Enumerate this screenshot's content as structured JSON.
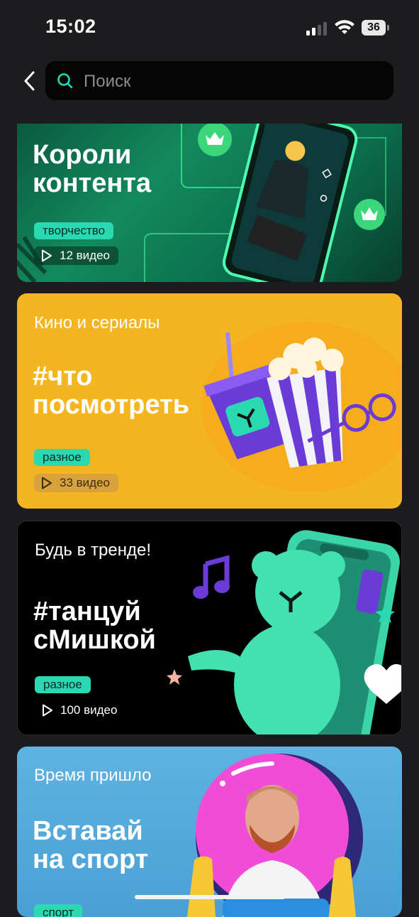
{
  "status_bar": {
    "time": "15:02",
    "battery": "36"
  },
  "search": {
    "placeholder": "Поиск"
  },
  "cards": [
    {
      "kicker": "",
      "title_line1": "Короли",
      "title_line2": "контента",
      "tag": "творчество",
      "count": "12 видео"
    },
    {
      "kicker": "Кино и сериалы",
      "title_line1": "#что",
      "title_line2": "посмотреть",
      "tag": "разное",
      "count": "33 видео"
    },
    {
      "kicker": "Будь в тренде!",
      "title_line1": "#танцуй",
      "title_line2": "сМишкой",
      "tag": "разное",
      "count": "100 видео"
    },
    {
      "kicker": "Время пришло",
      "title_line1": "Вставай",
      "title_line2": "на спорт",
      "tag": "спорт",
      "count": ""
    }
  ],
  "icons": {
    "back": "chevron-left-icon",
    "search": "search-icon",
    "play": "play-icon",
    "signal": "signal-icon",
    "wifi": "wifi-icon",
    "battery": "battery-icon"
  },
  "colors": {
    "accent": "#2ad8b2",
    "card_yellow": "#f5b521",
    "card_blue": "#5fb3e0",
    "card_green": "#138a5e"
  }
}
